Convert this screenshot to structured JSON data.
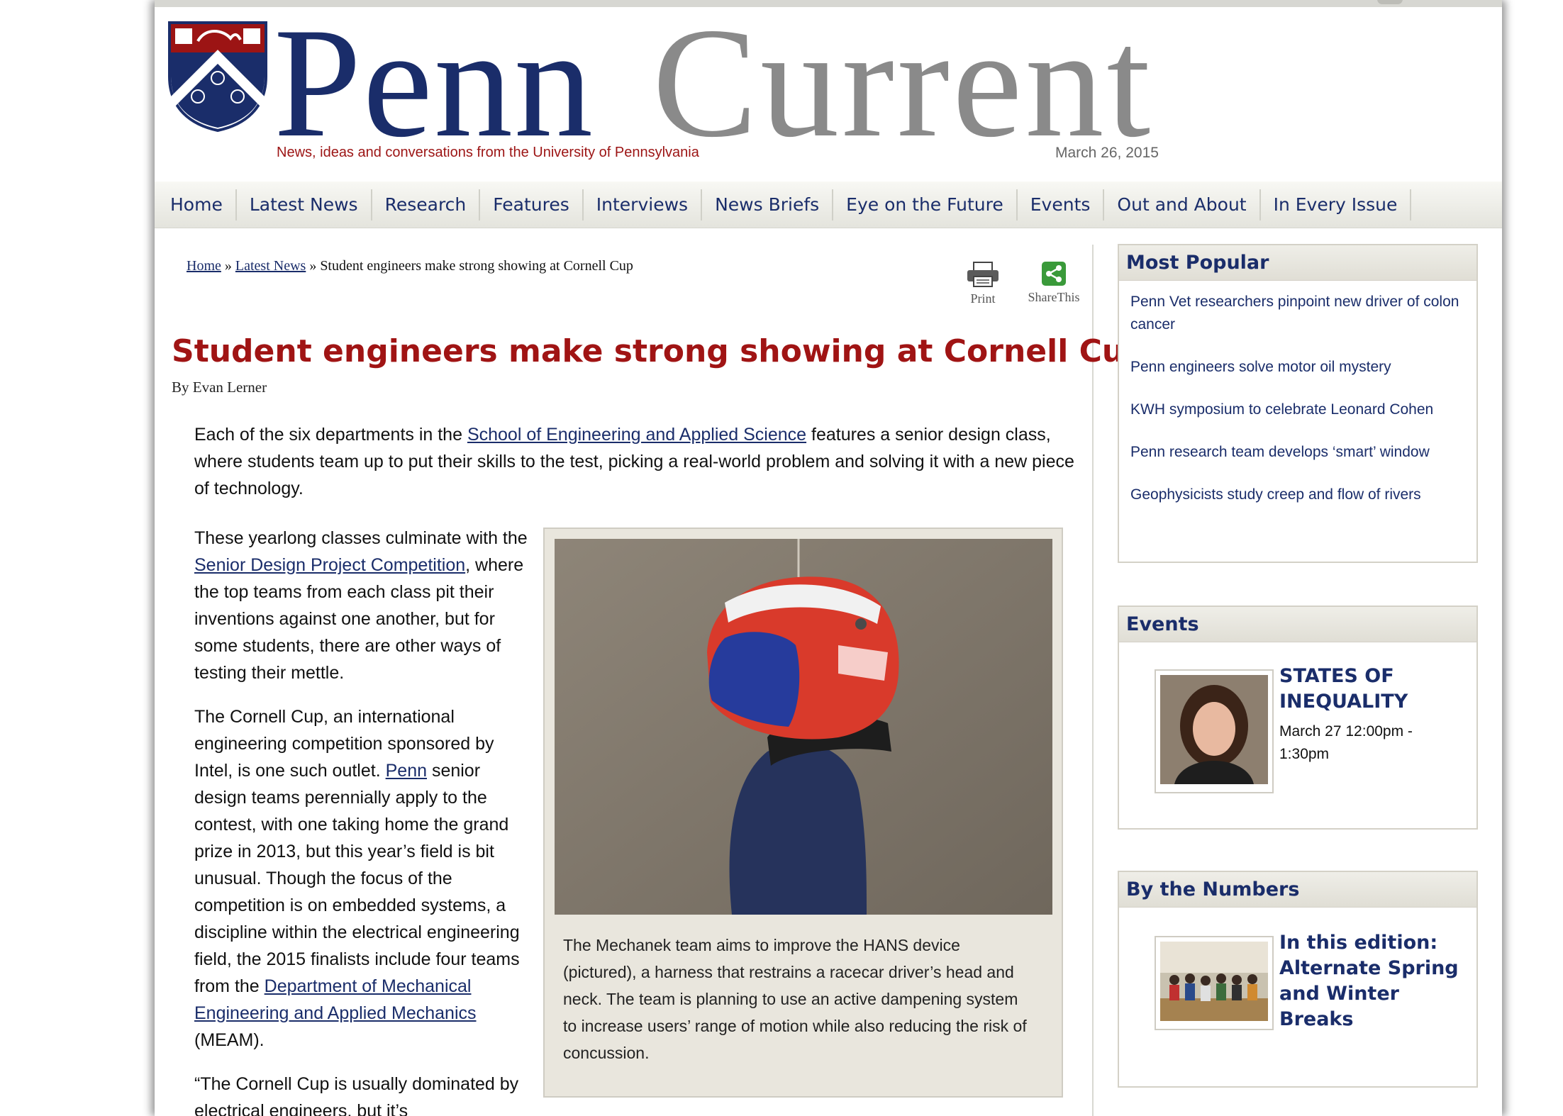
{
  "header": {
    "logo_penn": "Penn",
    "logo_current": "Current",
    "tagline": "News, ideas and conversations from the University of Pennsylvania",
    "date": "March 26, 2015"
  },
  "nav": {
    "items": [
      {
        "label": "Home"
      },
      {
        "label": "Latest News"
      },
      {
        "label": "Research"
      },
      {
        "label": "Features"
      },
      {
        "label": "Interviews"
      },
      {
        "label": "News Briefs"
      },
      {
        "label": "Eye on the Future"
      },
      {
        "label": "Events"
      },
      {
        "label": "Out and About"
      },
      {
        "label": "In Every Issue"
      }
    ]
  },
  "breadcrumb": {
    "home": "Home",
    "sep1": " » ",
    "latest": "Latest News",
    "sep2": " » ",
    "current": "Student engineers make strong showing at Cornell Cup"
  },
  "tools": {
    "print_label": "Print",
    "share_label": "ShareThis",
    "print_icon": "printer-icon",
    "share_icon": "share-icon",
    "share_color": "#3a9a3a"
  },
  "article": {
    "headline": "Student engineers make strong showing at Cornell Cup",
    "byline": "By Evan Lerner",
    "intro_a": "Each of the six departments in the ",
    "intro_link": "School of Engineering and Applied Science",
    "intro_b": " features a senior design class, where students team up to put their skills to the test, picking a real-world problem and solving it with a new piece of technology.",
    "p2_a": "These yearlong classes culminate with the ",
    "p2_link": "Senior Design Project Competition",
    "p2_b": ", where the top teams from each class pit their inventions against one another, but for some students, there are other ways of testing their mettle.",
    "p3_a": "The Cornell Cup, an international engineering competition sponsored by Intel, is one such outlet. ",
    "p3_link1": "Penn",
    "p3_b": " senior design teams perennially apply to the contest, with one taking home the grand prize in 2013, but this year’s field is bit unusual. Though the focus of the competition is on embedded systems, a discipline within the electrical engineering field, the 2015 finalists include four teams from the ",
    "p3_link2": "Department of Mechanical Engineering and Applied Mechanics",
    "p3_c": " (MEAM).",
    "p4": "“The Cornell Cup is usually dominated by electrical engineers, but it’s",
    "caption": "The Mechanek team aims to improve the HANS device (pictured), a harness that restrains a racecar driver’s head and neck. The team is planning to use an active dampening system to increase users’ range of motion while also reducing the risk of concussion."
  },
  "sidebar": {
    "popular": {
      "title": "Most Popular",
      "items": [
        {
          "label": "Penn Vet researchers pinpoint new driver of colon cancer"
        },
        {
          "label": "Penn engineers solve motor oil mystery"
        },
        {
          "label": "KWH symposium to celebrate Leonard Cohen"
        },
        {
          "label": "Penn research team develops ‘smart’ window"
        },
        {
          "label": "Geophysicists study creep and flow of rivers"
        }
      ]
    },
    "events": {
      "title": "Events",
      "event_title": "STATES OF INEQUALITY",
      "event_time": "March 27 12:00pm - 1:30pm"
    },
    "numbers": {
      "title": "By the Numbers",
      "item_title": "In this edition: Alternate Spring and Winter Breaks"
    }
  },
  "colors": {
    "navy": "#1a2d6a",
    "red": "#a01414",
    "gray_logo": "#8a8a8a"
  }
}
